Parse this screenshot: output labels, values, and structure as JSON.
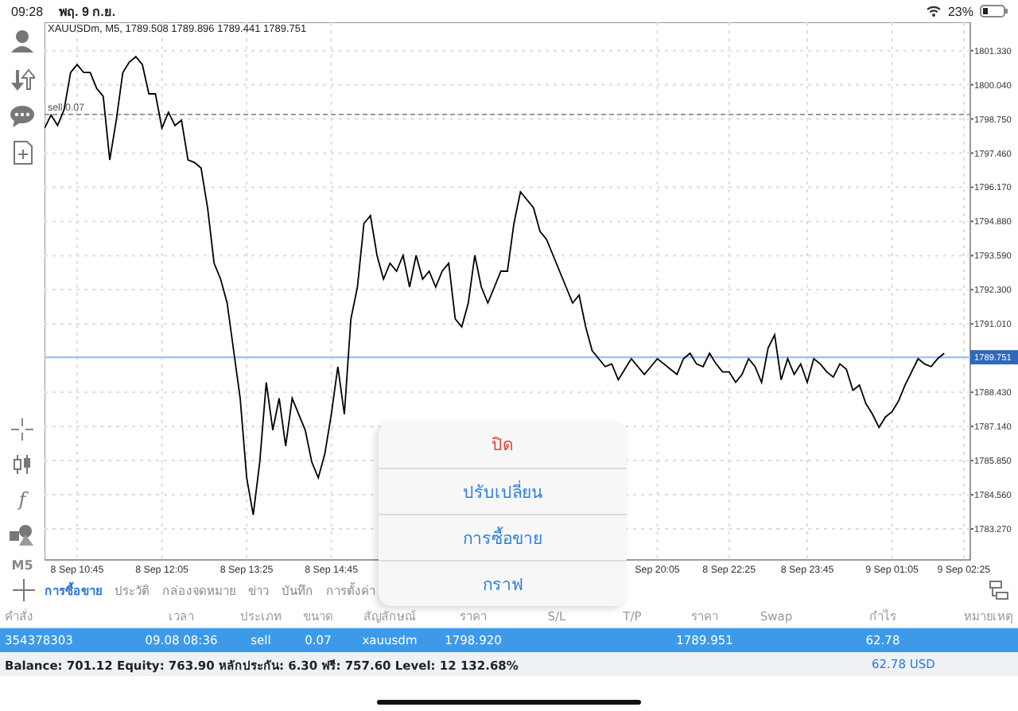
{
  "status_bar": {
    "time": "09:28",
    "date": "พฤ. 9 ก.ย.",
    "battery": "23%"
  },
  "chart": {
    "header": "XAUUSDm, M5, 1789.508 1789.896 1789.441 1789.751",
    "timeframe": "M5",
    "indicators_label": "f",
    "chart_data": {
      "type": "line",
      "grid": true,
      "ylim": [
        1782.1,
        1802.4
      ],
      "categories": [
        null,
        null,
        null,
        null,
        null,
        "8 Sep 10:45",
        null,
        null,
        null,
        null,
        null,
        null,
        null,
        null,
        null,
        null,
        null,
        null,
        "8 Sep 12:05",
        null,
        null,
        null,
        null,
        null,
        null,
        null,
        null,
        null,
        null,
        null,
        null,
        "8 Sep 13:25",
        null,
        null,
        null,
        null,
        null,
        null,
        null,
        null,
        null,
        null,
        null,
        null,
        "8 Sep 14:45",
        null,
        null,
        null,
        null,
        null,
        null,
        null,
        null,
        null,
        null,
        null,
        null,
        null,
        null,
        null,
        null,
        null,
        null,
        null,
        null,
        null,
        null,
        null,
        null,
        null,
        null,
        null,
        null,
        null,
        null,
        null,
        null,
        null,
        null,
        null,
        null,
        null,
        null,
        null,
        null,
        null,
        null,
        null,
        null,
        null,
        null,
        null,
        null,
        null,
        "Sep 20:05",
        null,
        null,
        null,
        null,
        null,
        null,
        null,
        null,
        null,
        null,
        "8 Sep 22:25",
        null,
        null,
        null,
        null,
        null,
        null,
        null,
        null,
        null,
        null,
        null,
        "8 Sep 23:45",
        null,
        null,
        null,
        null,
        null,
        null,
        null,
        null,
        null,
        null,
        null,
        null,
        "9 Sep 01:05",
        null,
        null,
        null,
        null,
        null,
        null,
        null,
        null,
        null,
        null,
        "9 Sep 02:25",
        null
      ],
      "yticks": [
        {
          "value": 1801.33,
          "label": "1801.330"
        },
        {
          "value": 1800.04,
          "label": "1800.040"
        },
        {
          "value": 1798.75,
          "label": "1798.750"
        },
        {
          "value": 1797.46,
          "label": "1797.460"
        },
        {
          "value": 1796.17,
          "label": "1796.170"
        },
        {
          "value": 1794.88,
          "label": "1794.880"
        },
        {
          "value": 1793.59,
          "label": "1793.590"
        },
        {
          "value": 1792.3,
          "label": "1792.300"
        },
        {
          "value": 1791.01,
          "label": "1791.010"
        },
        {
          "value": 1788.43,
          "label": "1788.430"
        },
        {
          "value": 1787.14,
          "label": "1787.140"
        },
        {
          "value": 1785.85,
          "label": "1785.850"
        },
        {
          "value": 1784.56,
          "label": "1784.560"
        },
        {
          "value": 1783.27,
          "label": "1783.270"
        }
      ],
      "ref_lines": [
        {
          "axis": "y",
          "value": 1798.92,
          "label": "sell 0.07",
          "color": "#999999"
        },
        {
          "axis": "y",
          "value": 1789.751,
          "label": "1789.751",
          "color": "#a9c3e6"
        }
      ],
      "series": [
        {
          "color": "#000000",
          "values": [
            1798.4,
            1798.9,
            1798.5,
            1799.1,
            1800.5,
            1800.8,
            1800.5,
            1800.5,
            1799.9,
            1799.6,
            1797.2,
            1798.7,
            1800.5,
            1800.9,
            1801.1,
            1800.8,
            1799.7,
            1799.7,
            1798.4,
            1799.0,
            1798.5,
            1798.7,
            1797.2,
            1797.1,
            1796.9,
            1795.4,
            1793.3,
            1792.7,
            1791.8,
            1790.0,
            1788.2,
            1785.2,
            1783.8,
            1785.8,
            1788.8,
            1787.0,
            1788.2,
            1786.4,
            1788.2,
            1787.6,
            1787.0,
            1785.8,
            1785.2,
            1786.1,
            1787.6,
            1789.4,
            1787.6,
            1791.2,
            1792.4,
            1794.8,
            1795.1,
            1793.6,
            1792.7,
            1793.3,
            1793.0,
            1793.6,
            1792.4,
            1793.6,
            1792.7,
            1793.0,
            1792.4,
            1793.0,
            1793.3,
            1791.2,
            1790.9,
            1791.8,
            1793.6,
            1792.4,
            1791.8,
            1792.4,
            1793.0,
            1793.0,
            1794.8,
            1796.0,
            1795.7,
            1795.4,
            1794.5,
            1794.2,
            1793.6,
            1793.0,
            1792.4,
            1791.8,
            1792.1,
            1790.9,
            1790.0,
            1789.7,
            1789.4,
            1789.5,
            1788.9,
            1789.3,
            1789.7,
            1789.4,
            1789.1,
            1789.4,
            1789.7,
            1789.5,
            1789.3,
            1789.1,
            1789.7,
            1789.9,
            1789.5,
            1789.4,
            1789.9,
            1789.5,
            1789.2,
            1789.2,
            1788.8,
            1789.1,
            1789.7,
            1789.4,
            1788.8,
            1790.1,
            1790.6,
            1788.9,
            1789.7,
            1789.1,
            1789.5,
            1788.8,
            1789.7,
            1789.5,
            1789.2,
            1789.0,
            1789.5,
            1789.3,
            1788.5,
            1788.7,
            1788.0,
            1787.6,
            1787.1,
            1787.5,
            1787.7,
            1788.1,
            1788.7,
            1789.2,
            1789.7,
            1789.5,
            1789.4,
            1789.7,
            1789.9,
            null,
            null,
            null,
            null
          ]
        }
      ]
    }
  },
  "tabs": [
    {
      "label": "การซื้อขาย",
      "selected": true
    },
    {
      "label": "ประวัติ",
      "selected": false
    },
    {
      "label": "กล่องจดหมาย",
      "selected": false
    },
    {
      "label": "ข่าว",
      "selected": false
    },
    {
      "label": "บันทึก",
      "selected": false
    },
    {
      "label": "การตั้งค่า",
      "selected": false
    }
  ],
  "table": {
    "columns": [
      "คำสั่ง",
      "เวลา",
      "ประเภท",
      "ขนาด",
      "สัญลักษณ์",
      "ราคา",
      "S/L",
      "T/P",
      "ราคา",
      "Swap",
      "กำไร",
      "หมายเหตุ"
    ],
    "rows": [
      {
        "selected": true,
        "cells": [
          "354378303",
          "09.08 08:36",
          "sell",
          "0.07",
          "xauusdm",
          "1798.920",
          "",
          "",
          "1789.951",
          "",
          "62.78",
          ""
        ]
      }
    ]
  },
  "summary": {
    "text": "Balance: 701.12 Equity: 763.90 หลักประกัน: 6.30 ฟรี: 757.60 Level: 12 132.68%",
    "profit": "62.78 USD"
  },
  "popup_menu": [
    {
      "label": "ปิด",
      "kind": "destructive"
    },
    {
      "label": "ปรับเปลี่ยน",
      "kind": "default"
    },
    {
      "label": "การซื้อขาย",
      "kind": "default"
    },
    {
      "label": "กราฟ",
      "kind": "default"
    }
  ]
}
